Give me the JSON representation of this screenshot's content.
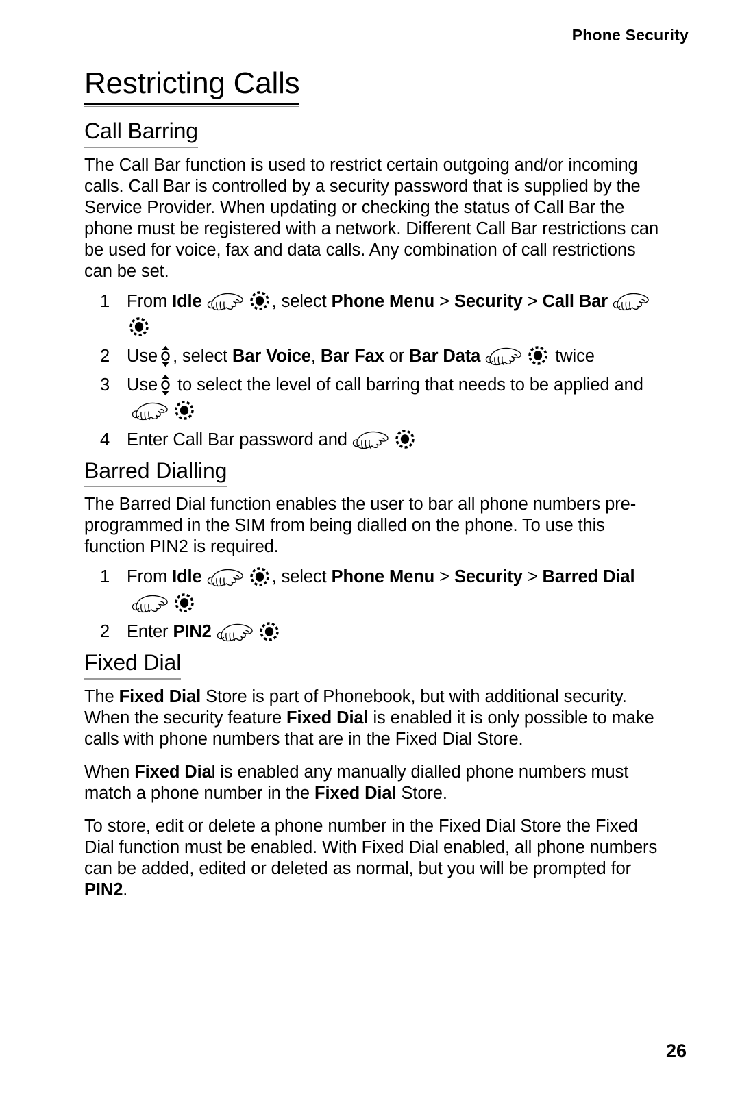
{
  "header": {
    "running_head": "Phone Security"
  },
  "chapter": {
    "title": "Restricting Calls"
  },
  "sections": [
    {
      "id": "call-barring",
      "heading": "Call Barring",
      "intro": "The Call Bar function is used to restrict certain outgoing and/or incoming calls. Call Bar is controlled by a security password that is supplied by  the Service Provider. When updating or checking the status of Call Bar the phone must be registered with a network. Different Call Bar restrictions can be used for voice, fax and data calls. Any combination of call restrictions can be set.",
      "steps": [
        {
          "number": "1",
          "parts": [
            {
              "t": "text",
              "v": "From "
            },
            {
              "t": "bold",
              "v": "Idle"
            },
            {
              "t": "icon",
              "v": "hand-press-icon"
            },
            {
              "t": "icon",
              "v": "select-key-icon"
            },
            {
              "t": "text",
              "v": ", select "
            },
            {
              "t": "bold",
              "v": "Phone Menu"
            },
            {
              "t": "text",
              "v": " > "
            },
            {
              "t": "bold",
              "v": "Security"
            },
            {
              "t": "text",
              "v": " > "
            },
            {
              "t": "bold",
              "v": "Call Bar"
            },
            {
              "t": "icon",
              "v": "hand-press-icon"
            },
            {
              "t": "icon",
              "v": "select-key-icon"
            }
          ]
        },
        {
          "number": "2",
          "parts": [
            {
              "t": "text",
              "v": "Use"
            },
            {
              "t": "icon",
              "v": "nav-updown-key-icon"
            },
            {
              "t": "text",
              "v": ",  select  "
            },
            {
              "t": "bold",
              "v": "Bar Voice"
            },
            {
              "t": "text",
              "v": ", "
            },
            {
              "t": "bold",
              "v": "Bar Fax"
            },
            {
              "t": "text",
              "v": " or "
            },
            {
              "t": "bold",
              "v": "Bar Data"
            },
            {
              "t": "icon",
              "v": "hand-press-icon"
            },
            {
              "t": "icon",
              "v": "select-key-icon"
            },
            {
              "t": "text",
              "v": " twice"
            }
          ]
        },
        {
          "number": "3",
          "parts": [
            {
              "t": "text",
              "v": "Use"
            },
            {
              "t": "icon",
              "v": "nav-updown-key-icon"
            },
            {
              "t": "text",
              "v": " to select the level of call barring that needs to be applied and"
            },
            {
              "t": "icon",
              "v": "hand-press-icon"
            },
            {
              "t": "icon",
              "v": "select-key-icon"
            }
          ]
        },
        {
          "number": "4",
          "parts": [
            {
              "t": "text",
              "v": "Enter Call Bar password and"
            },
            {
              "t": "icon",
              "v": "hand-press-icon"
            },
            {
              "t": "icon",
              "v": "select-key-icon"
            }
          ]
        }
      ]
    },
    {
      "id": "barred-dialling",
      "heading": "Barred Dialling",
      "intro": "The Barred Dial function enables the user to bar all phone numbers pre-programmed in the SIM from being dialled on the phone. To use this function PIN2 is required.",
      "steps": [
        {
          "number": "1",
          "parts": [
            {
              "t": "text",
              "v": "From "
            },
            {
              "t": "bold",
              "v": "Idle"
            },
            {
              "t": "icon",
              "v": "hand-press-icon"
            },
            {
              "t": "icon",
              "v": "select-key-icon"
            },
            {
              "t": "text",
              "v": ", select "
            },
            {
              "t": "bold",
              "v": "Phone Menu"
            },
            {
              "t": "text",
              "v": " > "
            },
            {
              "t": "bold",
              "v": "Security"
            },
            {
              "t": "text",
              "v": " > "
            },
            {
              "t": "bold",
              "v": "Barred Dial"
            },
            {
              "t": "icon",
              "v": "hand-press-icon"
            },
            {
              "t": "icon",
              "v": "select-key-icon"
            }
          ]
        },
        {
          "number": "2",
          "parts": [
            {
              "t": "text",
              "v": "Enter "
            },
            {
              "t": "bold",
              "v": "PIN2"
            },
            {
              "t": "icon",
              "v": "hand-press-icon"
            },
            {
              "t": "icon",
              "v": "select-key-icon"
            }
          ]
        }
      ]
    },
    {
      "id": "fixed-dial",
      "heading": "Fixed Dial",
      "paragraphs": [
        [
          {
            "t": "text",
            "v": "The "
          },
          {
            "t": "bold",
            "v": "Fixed Dial"
          },
          {
            "t": "text",
            "v": " Store is part of Phonebook, but with additional security. When the security feature "
          },
          {
            "t": "bold",
            "v": "Fixed Dial"
          },
          {
            "t": "text",
            "v": " is enabled it is only possible to make calls with phone numbers that are in the Fixed Dial Store."
          }
        ],
        [
          {
            "t": "text",
            "v": "When "
          },
          {
            "t": "bold",
            "v": "Fixed Dia"
          },
          {
            "t": "text",
            "v": "l is enabled any manually dialled phone numbers must match a phone number in the "
          },
          {
            "t": "bold",
            "v": "Fixed Dial"
          },
          {
            "t": "text",
            "v": " Store."
          }
        ],
        [
          {
            "t": "text",
            "v": "To store, edit or delete a phone number in the Fixed Dial Store the Fixed Dial function must be enabled. With Fixed Dial enabled, all phone numbers can be added, edited or deleted as normal, but you will be prompted for "
          },
          {
            "t": "bold",
            "v": "PIN2"
          },
          {
            "t": "text",
            "v": "."
          }
        ]
      ]
    }
  ],
  "footer": {
    "page_number": "26"
  },
  "colors": {
    "text": "#000000",
    "rule": "#9a9a9a",
    "background": "#ffffff"
  }
}
